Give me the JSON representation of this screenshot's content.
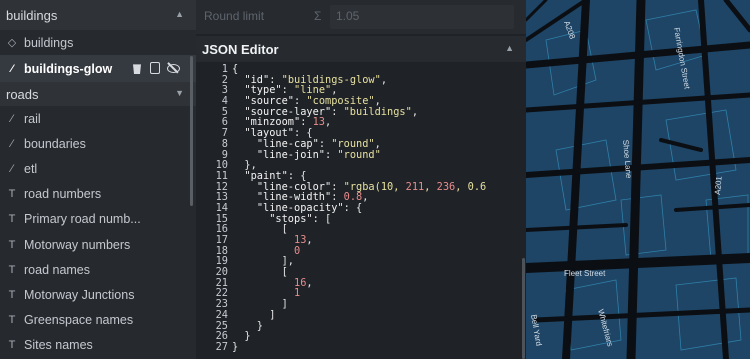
{
  "layers_panel": {
    "groups": [
      {
        "label": "buildings",
        "items": [
          {
            "label": "buildings",
            "icon": "diamond-outline-icon",
            "glyph": "◇",
            "selected": false
          },
          {
            "label": "buildings-glow",
            "icon": "line-icon",
            "glyph": "⁄",
            "selected": true
          }
        ]
      },
      {
        "label": "roads",
        "items": [
          {
            "label": "rail",
            "icon": "line-icon",
            "glyph": "⁄"
          },
          {
            "label": "boundaries",
            "icon": "line-icon",
            "glyph": "⁄"
          },
          {
            "label": "etl",
            "icon": "line-icon",
            "glyph": "⁄"
          },
          {
            "label": "road numbers",
            "icon": "text-icon",
            "glyph": "T"
          },
          {
            "label": "Primary road numb...",
            "icon": "text-icon",
            "glyph": "T"
          },
          {
            "label": "Motorway numbers",
            "icon": "text-icon",
            "glyph": "T"
          },
          {
            "label": "road names",
            "icon": "text-icon",
            "glyph": "T"
          },
          {
            "label": "Motorway Junctions",
            "icon": "text-icon",
            "glyph": "T"
          },
          {
            "label": "Greenspace names",
            "icon": "text-icon",
            "glyph": "T"
          },
          {
            "label": "Sites names",
            "icon": "text-icon",
            "glyph": "T"
          }
        ]
      }
    ]
  },
  "round_limit": {
    "label": "Round limit",
    "sigma": "Σ",
    "value": "1.05"
  },
  "json_editor": {
    "title": "JSON Editor",
    "lines": [
      "{",
      "  \"id\": \"buildings-glow\",",
      "  \"type\": \"line\",",
      "  \"source\": \"composite\",",
      "  \"source-layer\": \"buildings\",",
      "  \"minzoom\": 13,",
      "  \"layout\": {",
      "    \"line-cap\": \"round\",",
      "    \"line-join\": \"round\"",
      "  },",
      "  \"paint\": {",
      "    \"line-color\": \"rgba(10, 211, 236, 0.6",
      "    \"line-width\": 0.8,",
      "    \"line-opacity\": {",
      "      \"stops\": [",
      "        [",
      "          13,",
      "          0",
      "        ],",
      "        [",
      "          16,",
      "          1",
      "        ]",
      "      ]",
      "    }",
      "  }",
      "}"
    ]
  },
  "map": {
    "labels": [
      "A208",
      "Farringdon Street",
      "Shoe Lane",
      "A201",
      "Fleet Street",
      "Whitefriars",
      "Bell Yard"
    ],
    "colors": {
      "background": "#1e4566",
      "roads": "#0b0f14",
      "outline": "#2f7fa8"
    }
  }
}
